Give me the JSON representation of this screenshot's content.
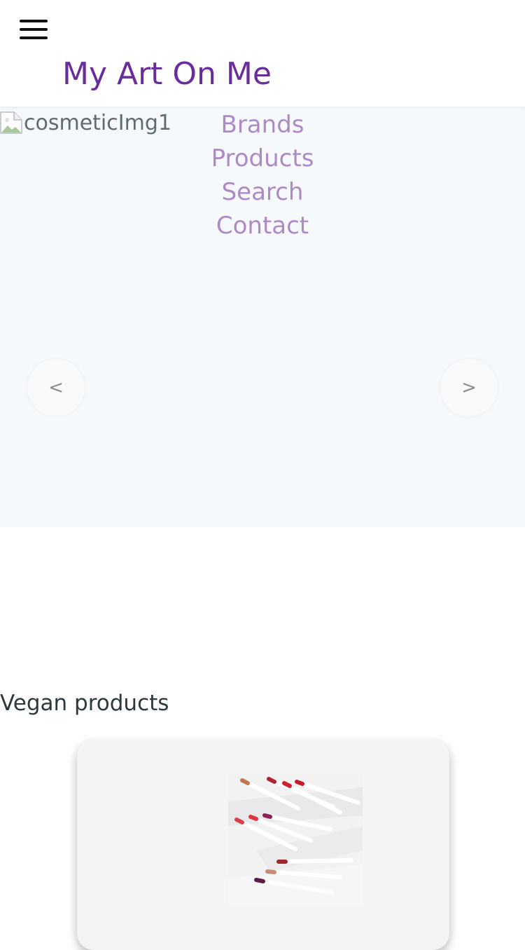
{
  "header": {
    "menu_icon": "hamburger-menu-icon",
    "site_title": "My Art On Me",
    "title_color": "#6a2e9c"
  },
  "hero": {
    "image_alt": "cosmeticImg1",
    "nav_items": [
      {
        "label": "Brands"
      },
      {
        "label": "Products"
      },
      {
        "label": "Search"
      },
      {
        "label": "Contact"
      }
    ],
    "nav_color": "#ad8ac4",
    "prev_label": "<",
    "next_label": ">"
  },
  "vegan_section": {
    "title": "Vegan products",
    "products": [
      {
        "image_icon": "lip-pencils-product-image"
      }
    ]
  }
}
